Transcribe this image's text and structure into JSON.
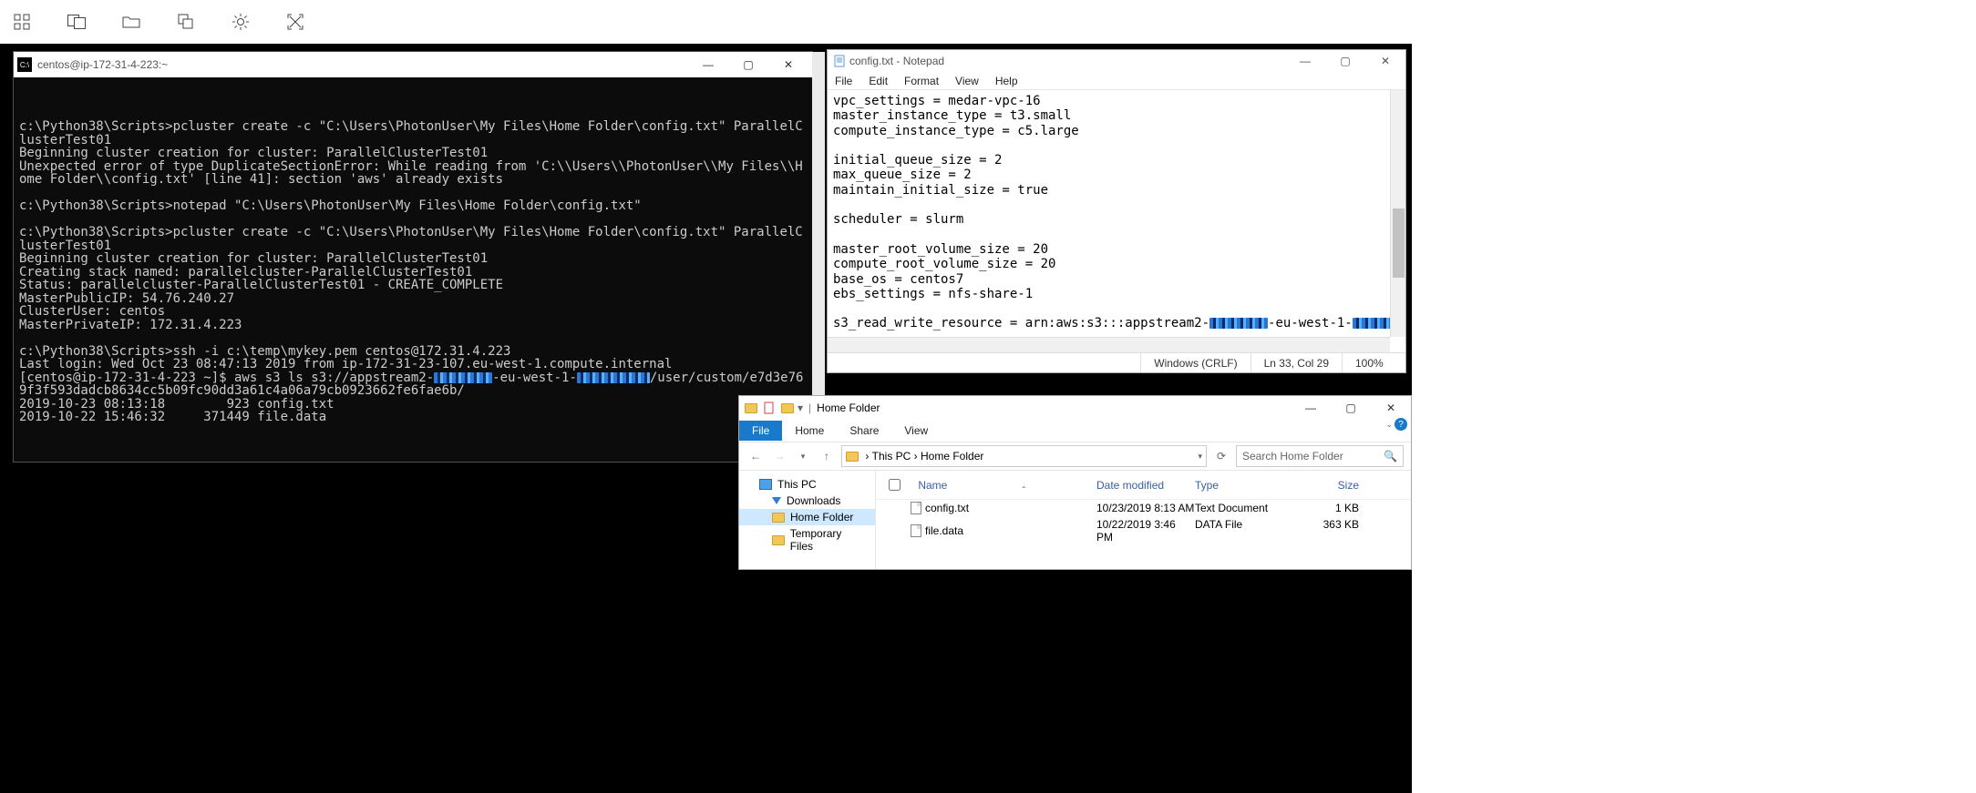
{
  "toolbar_icons": [
    "apps",
    "dual-monitor",
    "folder",
    "copy",
    "settings",
    "fullscreen"
  ],
  "terminal": {
    "title": "centos@ip-172-31-4-223:~",
    "lines": [
      "c:\\Python38\\Scripts>pcluster create -c \"C:\\Users\\PhotonUser\\My Files\\Home Folder\\config.txt\" ParallelClusterTest01",
      "Beginning cluster creation for cluster: ParallelClusterTest01",
      "Unexpected error of type DuplicateSectionError: While reading from 'C:\\\\Users\\\\PhotonUser\\\\My Files\\\\Home Folder\\\\config.txt' [line 41]: section 'aws' already exists",
      "",
      "c:\\Python38\\Scripts>notepad \"C:\\Users\\PhotonUser\\My Files\\Home Folder\\config.txt\"",
      "",
      "c:\\Python38\\Scripts>pcluster create -c \"C:\\Users\\PhotonUser\\My Files\\Home Folder\\config.txt\" ParallelClusterTest01",
      "Beginning cluster creation for cluster: ParallelClusterTest01",
      "Creating stack named: parallelcluster-ParallelClusterTest01",
      "Status: parallelcluster-ParallelClusterTest01 - CREATE_COMPLETE",
      "MasterPublicIP: 54.76.240.27",
      "ClusterUser: centos",
      "MasterPrivateIP: 172.31.4.223",
      "",
      "c:\\Python38\\Scripts>ssh -i c:\\temp\\mykey.pem centos@172.31.4.223",
      "Last login: Wed Oct 23 08:47:13 2019 from ip-172-31-23-107.eu-west-1.compute.internal"
    ],
    "aws_ls": {
      "prompt": "[centos@ip-172-31-4-223 ~]$ ",
      "cmd_pre": "aws s3 ls s3://appstream2-",
      "cmd_mid": "-eu-west-1-",
      "cmd_post": "/user/custom/e7d3e769f3f593dadcb8634cc5b09fc90dd3a61c4a06a79cb0923662fe6fae6b/"
    },
    "ls_out": [
      "2019-10-23 08:13:18        923 config.txt",
      "2019-10-22 15:46:32     371449 file.data"
    ]
  },
  "notepad": {
    "title": "config.txt - Notepad",
    "menus": [
      "File",
      "Edit",
      "Format",
      "View",
      "Help"
    ],
    "content_lines": [
      "vpc_settings = medar-vpc-16",
      "master_instance_type = t3.small",
      "compute_instance_type = c5.large",
      "",
      "initial_queue_size = 2",
      "max_queue_size = 2",
      "maintain_initial_size = true",
      "",
      "scheduler = slurm",
      "",
      "master_root_volume_size = 20",
      "compute_root_volume_size = 20",
      "base_os = centos7",
      "ebs_settings = nfs-share-1",
      ""
    ],
    "s3_line": {
      "pre": "s3_read_write_resource = arn:aws:s3:::appstream2-",
      "mid": "-eu-west-1-",
      "post": "*"
    },
    "status": {
      "encoding": "Windows (CRLF)",
      "pos": "Ln 33, Col 29",
      "zoom": "100%"
    }
  },
  "explorer": {
    "title": "Home Folder",
    "tabs": [
      "File",
      "Home",
      "Share",
      "View"
    ],
    "breadcrumb": [
      "This PC",
      "Home Folder"
    ],
    "search_placeholder": "Search Home Folder",
    "tree": [
      {
        "label": "This PC",
        "icon": "pc",
        "indent": 0
      },
      {
        "label": "Downloads",
        "icon": "dl",
        "indent": 1
      },
      {
        "label": "Home Folder",
        "icon": "folder",
        "indent": 1,
        "selected": true
      },
      {
        "label": "Temporary Files",
        "icon": "folder",
        "indent": 1
      }
    ],
    "cols": [
      "Name",
      "Date modified",
      "Type",
      "Size"
    ],
    "rows": [
      {
        "name": "config.txt",
        "date": "10/23/2019 8:13 AM",
        "type": "Text Document",
        "size": "1 KB",
        "icon": "file"
      },
      {
        "name": "file.data",
        "date": "10/22/2019 3:46 PM",
        "type": "DATA File",
        "size": "363 KB",
        "icon": "file"
      }
    ]
  }
}
